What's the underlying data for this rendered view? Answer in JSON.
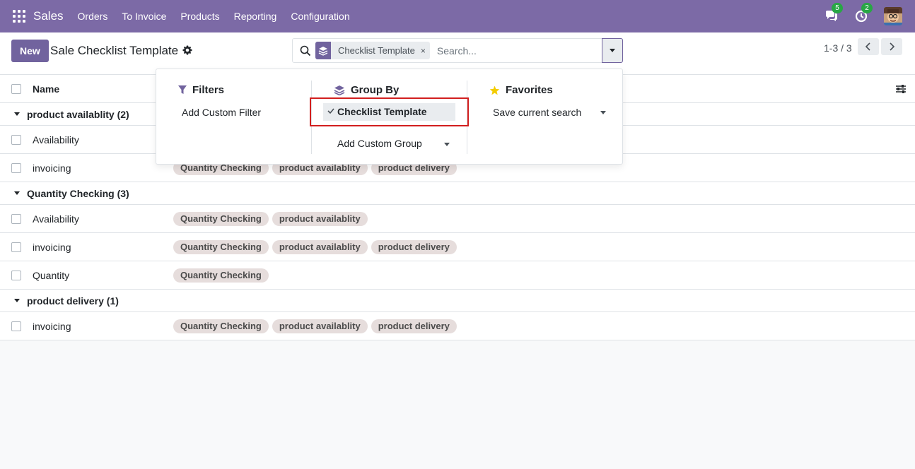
{
  "navbar": {
    "app_name": "Sales",
    "menu": [
      "Orders",
      "To Invoice",
      "Products",
      "Reporting",
      "Configuration"
    ],
    "messages_count": "5",
    "activities_count": "2",
    "icons": [
      "apps-grid-icon",
      "chat-icon",
      "clock-icon",
      "user-avatar"
    ]
  },
  "control_panel": {
    "new_label": "New",
    "title": "Sale Checklist Template",
    "search": {
      "facet_label": "Checklist Template",
      "facet_remove": "×",
      "placeholder": "Search..."
    },
    "pager": "1-3 / 3"
  },
  "list": {
    "column_name": "Name",
    "groups": [
      {
        "label": "product availablity (2)",
        "rows": [
          {
            "name": "Availability",
            "tags": []
          },
          {
            "name": "invoicing",
            "tags": [
              "Quantity Checking",
              "product availablity",
              "product delivery"
            ]
          }
        ]
      },
      {
        "label": "Quantity Checking (3)",
        "rows": [
          {
            "name": "Availability",
            "tags": [
              "Quantity Checking",
              "product availablity"
            ]
          },
          {
            "name": "invoicing",
            "tags": [
              "Quantity Checking",
              "product availablity",
              "product delivery"
            ]
          },
          {
            "name": "Quantity",
            "tags": [
              "Quantity Checking"
            ]
          }
        ]
      },
      {
        "label": "product delivery (1)",
        "rows": [
          {
            "name": "invoicing",
            "tags": [
              "Quantity Checking",
              "product availablity",
              "product delivery"
            ]
          }
        ]
      }
    ]
  },
  "dropdown": {
    "filters_heading": "Filters",
    "add_custom_filter": "Add Custom Filter",
    "groupby_heading": "Group By",
    "groupby_selected": "Checklist Template",
    "add_custom_group": "Add Custom Group",
    "favorites_heading": "Favorites",
    "save_current_search": "Save current search"
  },
  "colors": {
    "navbar": "#7c6aa6",
    "primary": "#71639e",
    "tag_bg": "#e6dddc",
    "highlight": "#d21f1f",
    "badge": "#28a745",
    "favorite_star": "#f3cc00"
  }
}
